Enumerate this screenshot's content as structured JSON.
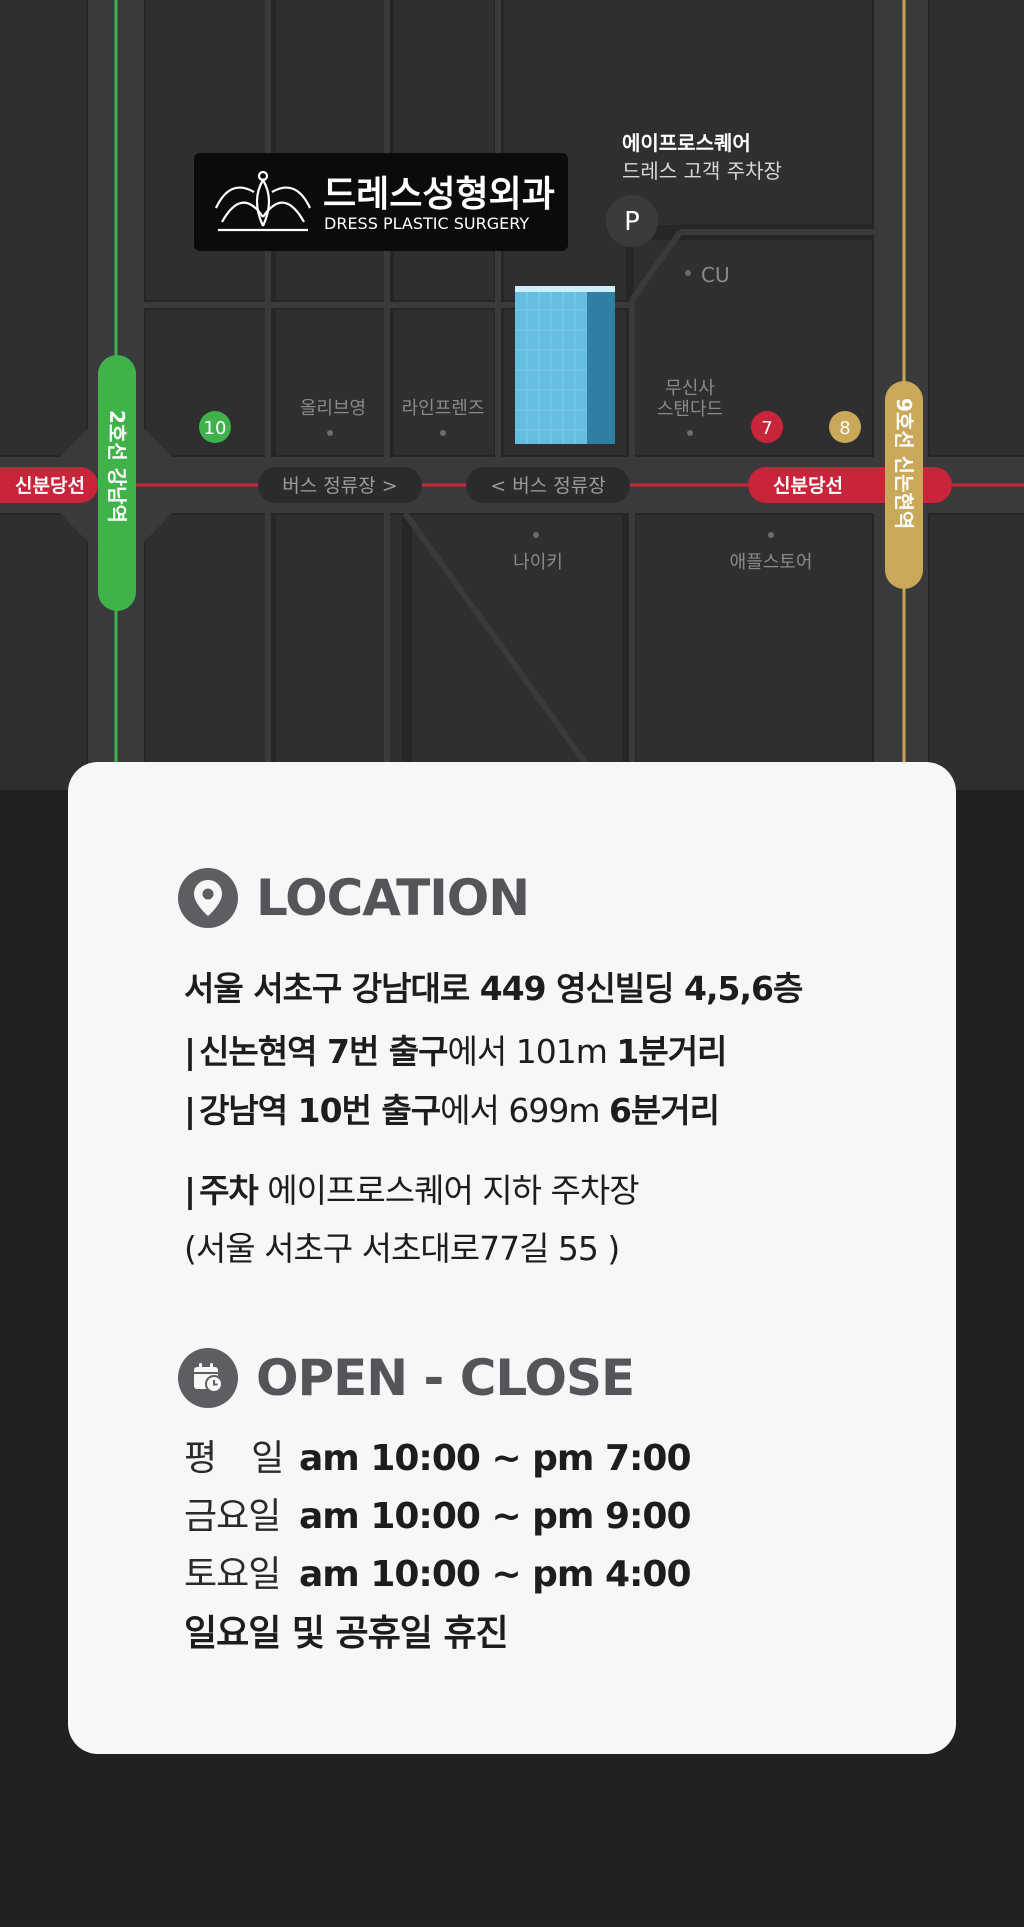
{
  "map": {
    "clinic_name_ko": "드레스성형외과",
    "clinic_name_en": "DRESS PLASTIC SURGERY",
    "parking_building": "에이프로스퀘어",
    "parking_label": "드레스 고객 주차장",
    "parking_marker": "P",
    "stations": {
      "line2": "2호선 강남역",
      "line9": "9호선 신논현역",
      "sinbundang_left": "신분당선",
      "sinbundang_right": "신분당선"
    },
    "exits": {
      "exit10": "10",
      "exit7": "7",
      "exit8": "8"
    },
    "bus_stop_right": "버스 정류장 >",
    "bus_stop_left": "< 버스 정류장",
    "pois": {
      "cu": "CU",
      "oliveyoung": "올리브영",
      "linefriends": "라인프렌즈",
      "musinsa_1": "무신사",
      "musinsa_2": "스탠다드",
      "nike": "나이키",
      "apple": "애플스토어"
    },
    "colors": {
      "line2": "#3fb24a",
      "line9": "#c9a85a",
      "sinbundang": "#c8253a",
      "background": "#262628"
    }
  },
  "location": {
    "title": "LOCATION",
    "address": "서울 서초구 강남대로 449 영신빌딩 4,5,6층",
    "route1": {
      "bar": "|",
      "station": "신논현역 7번 출구",
      "from": "에서 101m",
      "time": "1분거리"
    },
    "route2": {
      "bar": "|",
      "station": "강남역 10번 출구",
      "from": "에서 699m",
      "time": "6분거리"
    },
    "parking": {
      "bar": "|",
      "label": "주차",
      "value": "에이프로스퀘어 지하 주차장"
    },
    "parking_address": "(서울 서초구 서초대로77길 55 )"
  },
  "hours": {
    "title": "OPEN - CLOSE",
    "rows": [
      {
        "day": "평　일",
        "time": "am 10:00 ~ pm 7:00"
      },
      {
        "day": "금요일",
        "time": "am 10:00 ~ pm 9:00"
      },
      {
        "day": "토요일",
        "time": "am 10:00 ~ pm 4:00"
      }
    ],
    "closed": "일요일 및 공휴일 휴진"
  }
}
